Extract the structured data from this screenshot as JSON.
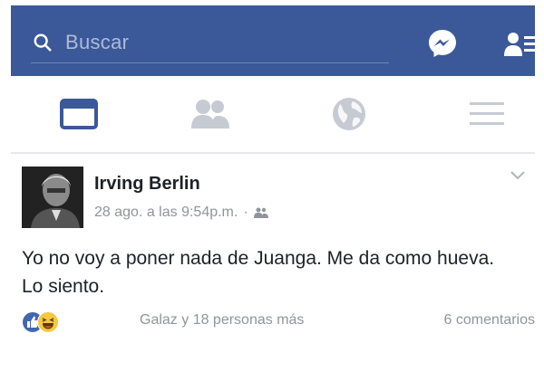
{
  "header": {
    "search_placeholder": "Buscar",
    "brand_color": "#3b5998",
    "icons": [
      "search-icon",
      "messenger-icon",
      "friend-requests-icon"
    ]
  },
  "tabs": [
    {
      "name": "news-feed",
      "icon": "news-feed-icon",
      "active": true
    },
    {
      "name": "friends",
      "icon": "friends-icon",
      "active": false
    },
    {
      "name": "notifications",
      "icon": "globe-icon",
      "active": false
    },
    {
      "name": "menu",
      "icon": "hamburger-menu-icon",
      "active": false
    }
  ],
  "post": {
    "author": "Irving Berlin",
    "timestamp": "28 ago. a las 9:54p.m.",
    "separator": "·",
    "privacy_icon": "friends-audience-icon",
    "text": "Yo no voy a poner nada de Juanga. Me da como hueva. Lo siento.",
    "reactions": {
      "types": [
        "like",
        "haha"
      ],
      "names": "Galaz y 18 personas más",
      "comments": "6 comentarios"
    }
  }
}
